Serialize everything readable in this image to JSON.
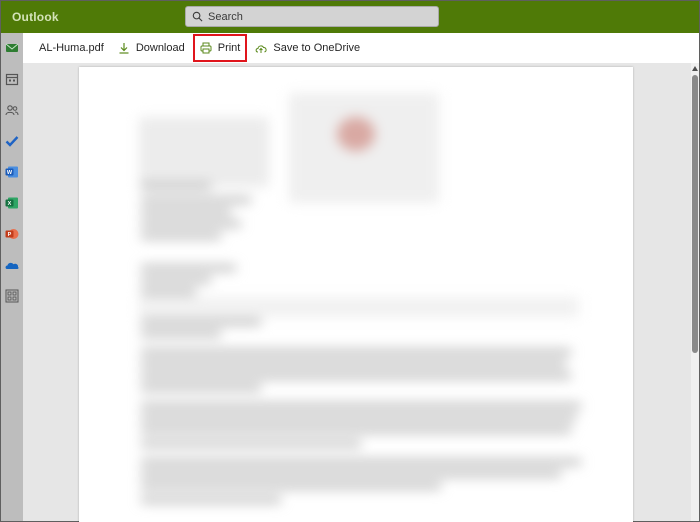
{
  "app": {
    "name": "Outlook",
    "brand_color": "#4f7a07",
    "accent_color": "#e0151c"
  },
  "search": {
    "placeholder": "Search",
    "icon": "search-icon"
  },
  "left_rail": {
    "items": [
      {
        "name": "mail",
        "icon": "mail-icon"
      },
      {
        "name": "calendar",
        "icon": "calendar-icon"
      },
      {
        "name": "people",
        "icon": "people-icon"
      },
      {
        "name": "todo",
        "icon": "checkmark-icon"
      },
      {
        "name": "word",
        "icon": "word-icon"
      },
      {
        "name": "excel",
        "icon": "excel-icon"
      },
      {
        "name": "powerpoint",
        "icon": "powerpoint-icon"
      },
      {
        "name": "onedrive",
        "icon": "onedrive-icon"
      },
      {
        "name": "apps",
        "icon": "apps-grid-icon"
      }
    ]
  },
  "toolbar": {
    "file_name": "AL-Huma.pdf",
    "download_label": "Download",
    "print_label": "Print",
    "save_label": "Save to OneDrive"
  }
}
